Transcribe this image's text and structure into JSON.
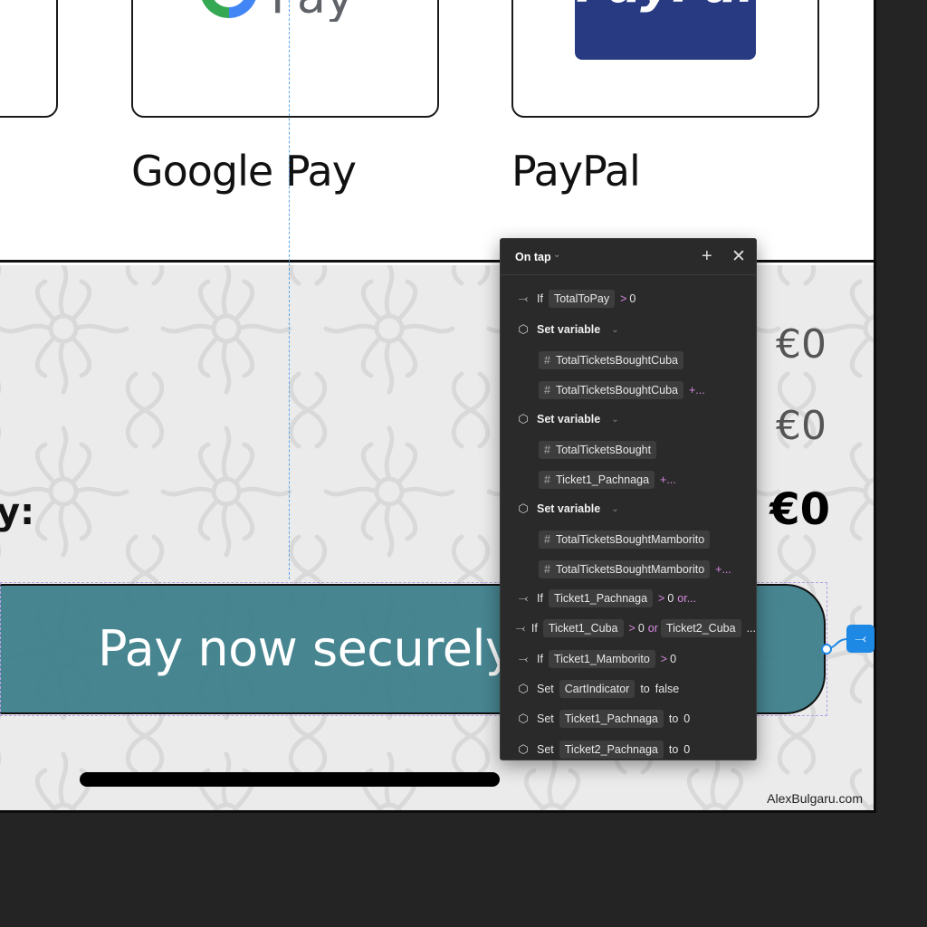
{
  "payment_methods": {
    "google_pay": {
      "label": "Google Pay",
      "logo_text": "Pay"
    },
    "paypal": {
      "label": "PayPal",
      "logo_text": "PayPal"
    }
  },
  "summary": {
    "price_1": "€0",
    "price_2": "€0",
    "total_label": "y:",
    "total": "€0"
  },
  "pay_button": {
    "label": "Pay now securely"
  },
  "watermark": "AlexBulgaru.com",
  "interaction_panel": {
    "trigger": "On tap",
    "rows": [
      {
        "type": "if",
        "keyword": "If",
        "var": "TotalToPay",
        "op": ">",
        "value": "0"
      },
      {
        "type": "set_variable",
        "keyword": "Set variable"
      },
      {
        "type": "var",
        "var": "TotalTicketsBoughtCuba"
      },
      {
        "type": "var",
        "var": "TotalTicketsBoughtCuba",
        "more": "+..."
      },
      {
        "type": "set_variable",
        "keyword": "Set variable"
      },
      {
        "type": "var",
        "var": "TotalTicketsBought"
      },
      {
        "type": "var",
        "var": "Ticket1_Pachnaga",
        "more": "+..."
      },
      {
        "type": "set_variable",
        "keyword": "Set variable"
      },
      {
        "type": "var",
        "var": "TotalTicketsBoughtMamborito"
      },
      {
        "type": "var",
        "var": "TotalTicketsBoughtMamborito",
        "more": "+..."
      },
      {
        "type": "if",
        "keyword": "If",
        "var": "Ticket1_Pachnaga",
        "op": ">",
        "value": "0",
        "more": "or..."
      },
      {
        "type": "if2",
        "keyword": "If",
        "var": "Ticket1_Cuba",
        "op": ">",
        "value": "0",
        "joiner": "or",
        "var2": "Ticket2_Cuba",
        "more": "..."
      },
      {
        "type": "if",
        "keyword": "If",
        "var": "Ticket1_Mamborito",
        "op": ">",
        "value": "0"
      },
      {
        "type": "set",
        "keyword": "Set",
        "var": "CartIndicator",
        "to": "to",
        "value": "false"
      },
      {
        "type": "set",
        "keyword": "Set",
        "var": "Ticket1_Pachnaga",
        "to": "to",
        "value": "0"
      },
      {
        "type": "set",
        "keyword": "Set",
        "var": "Ticket2_Pachnaga",
        "to": "to",
        "value": "0"
      }
    ]
  },
  "colors": {
    "button": "#3a7d8a",
    "panel_bg": "#2a2a2a",
    "accent_connector": "#1e88e5",
    "operator_pink": "#d68ae0"
  }
}
